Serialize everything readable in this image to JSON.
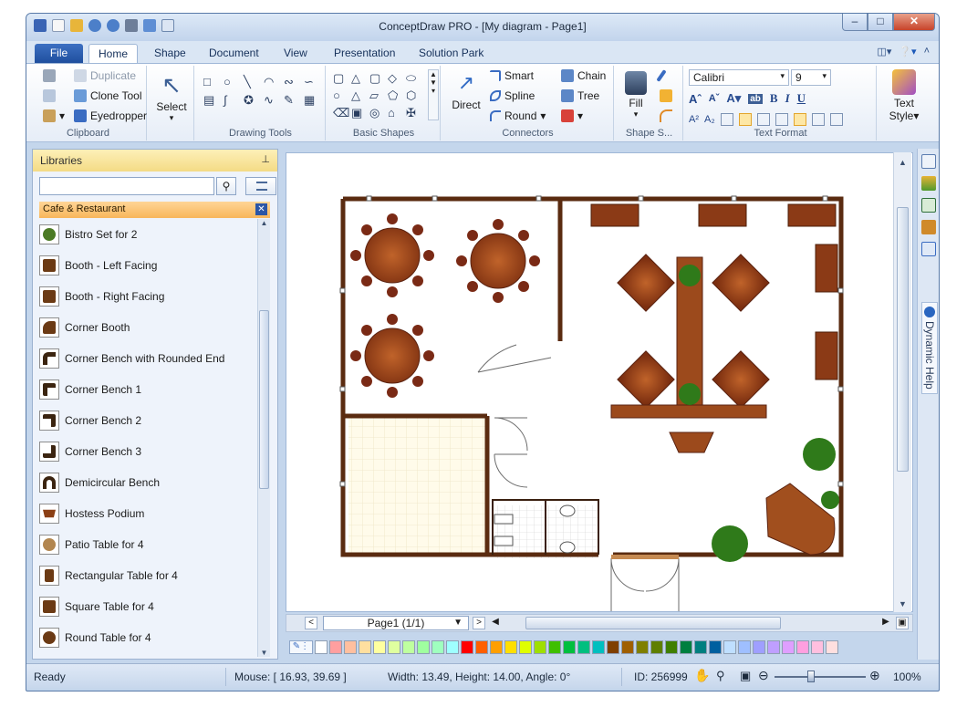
{
  "window": {
    "title": "ConceptDraw PRO - [My diagram - Page1]"
  },
  "tabs": [
    {
      "label": "File"
    },
    {
      "label": "Home"
    },
    {
      "label": "Shape"
    },
    {
      "label": "Document"
    },
    {
      "label": "View"
    },
    {
      "label": "Presentation"
    },
    {
      "label": "Solution Park"
    }
  ],
  "ribbon": {
    "clipboard": {
      "label": "Clipboard",
      "duplicate": "Duplicate",
      "clone_tool": "Clone Tool",
      "eyedropper": "Eyedropper"
    },
    "select": {
      "label": "Select"
    },
    "drawing_tools": {
      "label": "Drawing Tools"
    },
    "basic_shapes": {
      "label": "Basic Shapes"
    },
    "connectors": {
      "label": "Connectors",
      "direct": "Direct",
      "smart": "Smart",
      "spline": "Spline",
      "round": "Round",
      "chain": "Chain",
      "tree": "Tree"
    },
    "shape_style": {
      "label": "Shape S...",
      "fill": "Fill"
    },
    "text_format": {
      "label": "Text Format",
      "font": "Calibri",
      "size": "9"
    },
    "text_style": {
      "label": "Text Style"
    }
  },
  "library": {
    "title": "Libraries",
    "search_placeholder": "",
    "section": "Cafe & Restaurant",
    "items": [
      "Bistro Set for 2",
      "Booth - Left Facing",
      "Booth - Right Facing",
      "Corner Booth",
      "Corner Bench with Rounded End",
      "Corner Bench 1",
      "Corner Bench 2",
      "Corner Bench 3",
      "Demicircular Bench",
      "Hostess Podium",
      "Patio Table for 4",
      "Rectangular Table for 4",
      "Square Table for 4",
      "Round Table for 4"
    ]
  },
  "page_tabs": {
    "current": "Page1 (1/1)"
  },
  "right_strip": {
    "dynamic_help": "Dynamic Help"
  },
  "palette": [
    "#ffffff",
    "#ff9f9f",
    "#ffbf9f",
    "#ffdf9f",
    "#ffff9f",
    "#dfff9f",
    "#bfff9f",
    "#9fff9f",
    "#9fffbf",
    "#9fffff",
    "#ff0000",
    "#ff5f00",
    "#ff9f00",
    "#ffdf00",
    "#dfff00",
    "#9fdf00",
    "#3fbf00",
    "#00bf3f",
    "#00bf7f",
    "#00bfbf",
    "#7f3f00",
    "#9f5f00",
    "#7f7f00",
    "#5f7f00",
    "#3f7f00",
    "#007f3f",
    "#007f7f",
    "#005f9f",
    "#bfdfff",
    "#9fbfff",
    "#9f9fff",
    "#bf9fff",
    "#df9fff",
    "#ff9fdf",
    "#ffbfdf",
    "#ffdfdf"
  ],
  "status": {
    "ready": "Ready",
    "mouse": "Mouse: [ 16.93, 39.69 ]",
    "size": "Width: 13.49,  Height: 14.00,  Angle: 0°",
    "id": "ID: 256999",
    "zoom": "100%"
  }
}
